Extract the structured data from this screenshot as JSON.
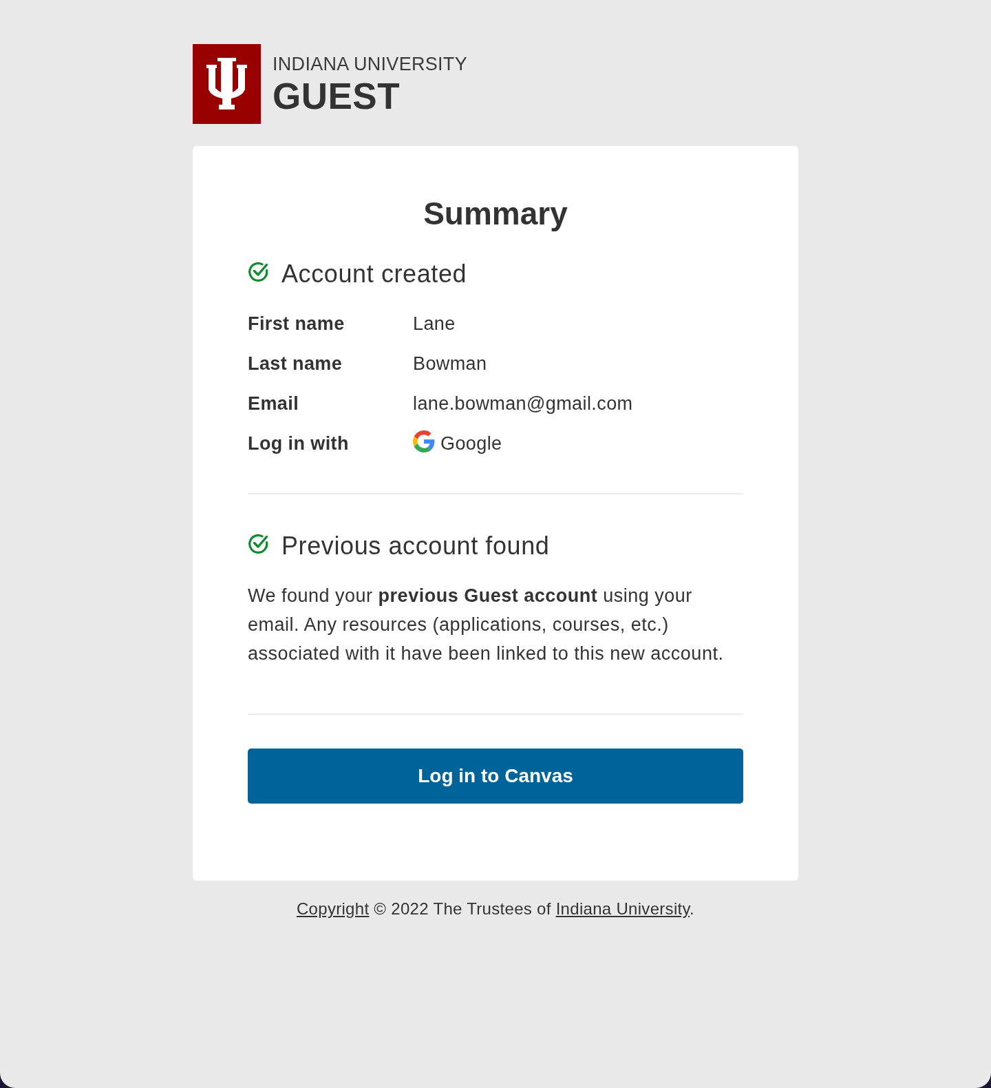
{
  "brand": {
    "university": "INDIANA UNIVERSITY",
    "product": "GUEST"
  },
  "card": {
    "title": "Summary",
    "sections": [
      {
        "kind": "details",
        "heading": "Account created",
        "done": true,
        "rows": [
          {
            "kind": "text",
            "label": "First name",
            "value": "Lane"
          },
          {
            "kind": "text",
            "label": "Last name",
            "value": "Bowman"
          },
          {
            "kind": "text",
            "label": "Email",
            "value": "lane.bowman@gmail.com"
          },
          {
            "kind": "provider",
            "label": "Log in with",
            "value": "Google"
          }
        ]
      },
      {
        "kind": "message",
        "heading": "Previous account found",
        "done": true,
        "text": "We found your **previous Guest account** using your email. Any resources (applications, courses, etc.) associated with it have been linked to this new account."
      }
    ],
    "button": "Log in to Canvas"
  },
  "footer": {
    "parts": [
      {
        "kind": "link",
        "text": "Copyright"
      },
      {
        "kind": "text",
        "text": " © 2022 The Trustees of "
      },
      {
        "kind": "link",
        "text": "Indiana University"
      },
      {
        "kind": "text",
        "text": "."
      }
    ]
  }
}
